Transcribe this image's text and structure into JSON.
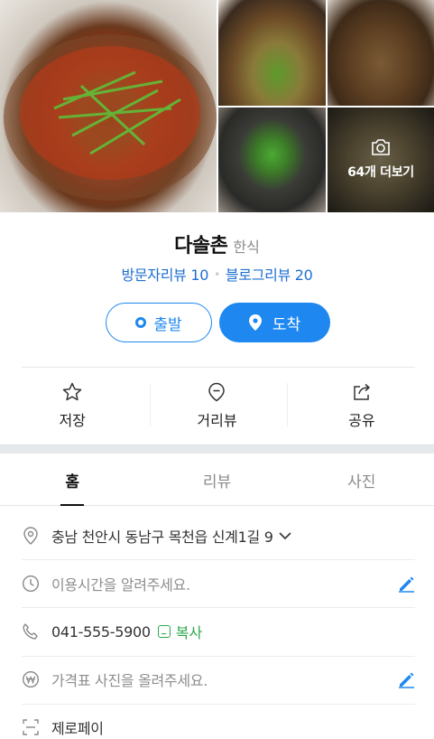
{
  "gallery": {
    "more_label": "64개 더보기"
  },
  "place": {
    "name": "다솔촌",
    "category": "한식",
    "visitor_reviews": "방문자리뷰 10",
    "blog_reviews": "블로그리뷰 20"
  },
  "route": {
    "start_label": "출발",
    "arrive_label": "도착"
  },
  "actions": {
    "save": "저장",
    "street_view": "거리뷰",
    "share": "공유"
  },
  "tabs": [
    "홈",
    "리뷰",
    "사진"
  ],
  "info": {
    "address": "충남 천안시 동남구 목천읍 신계1길 9",
    "hours_placeholder": "이용시간을 알려주세요.",
    "phone": "041-555-5900",
    "copy_label": "복사",
    "price_placeholder": "가격표 사진을 올려주세요.",
    "zeropay": "제로페이"
  },
  "colors": {
    "accent": "#1e88f0",
    "link": "#1e6fd0",
    "copy_green": "#2fa84a"
  }
}
